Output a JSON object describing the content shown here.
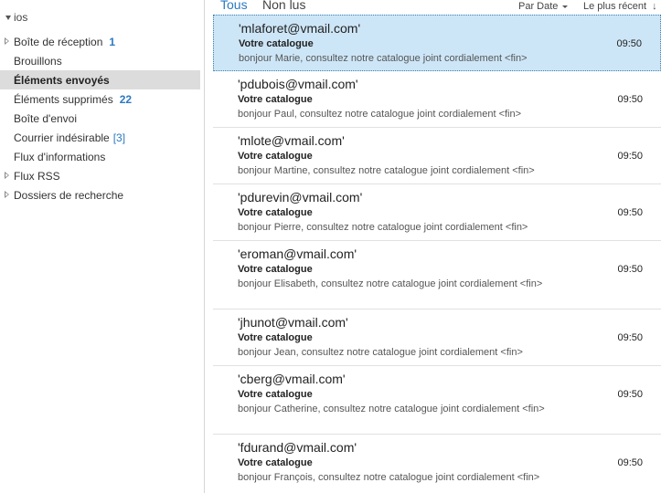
{
  "folder_pane": {
    "account": "ios",
    "folders": [
      {
        "label": "Boîte de réception",
        "count": "1",
        "count_style": "bold",
        "expandable": true,
        "active": false
      },
      {
        "label": "Brouillons",
        "count": "",
        "count_style": "",
        "expandable": false,
        "active": false
      },
      {
        "label": "Éléments envoyés",
        "count": "",
        "count_style": "",
        "expandable": false,
        "active": true
      },
      {
        "label": "Éléments supprimés",
        "count": "22",
        "count_style": "bold",
        "expandable": false,
        "active": false
      },
      {
        "label": "Boîte d'envoi",
        "count": "",
        "count_style": "",
        "expandable": false,
        "active": false
      },
      {
        "label": "Courrier indésirable",
        "count": "[3]",
        "count_style": "bracket",
        "expandable": false,
        "active": false
      },
      {
        "label": "Flux d'informations",
        "count": "",
        "count_style": "",
        "expandable": false,
        "active": false
      },
      {
        "label": "Flux RSS",
        "count": "",
        "count_style": "",
        "expandable": true,
        "active": false
      },
      {
        "label": "Dossiers de recherche",
        "count": "",
        "count_style": "",
        "expandable": true,
        "active": false
      }
    ]
  },
  "filter_bar": {
    "tab_all": "Tous",
    "tab_unread": "Non lus",
    "sort_by": "Par Date",
    "sort_order": "Le plus récent"
  },
  "messages": [
    {
      "sender": "'mlaforet@vmail.com'",
      "subject": "Votre catalogue",
      "preview": "bonjour Marie,    consultez notre catalogue joint  cordialement <fin>",
      "time": "09:50",
      "selected": true,
      "wrapped": false
    },
    {
      "sender": "'pdubois@vmail.com'",
      "subject": "Votre catalogue",
      "preview": "bonjour Paul,    consultez notre catalogue joint  cordialement <fin>",
      "time": "09:50",
      "selected": false,
      "wrapped": false
    },
    {
      "sender": "'mlote@vmail.com'",
      "subject": "Votre catalogue",
      "preview": "bonjour Martine,    consultez notre catalogue joint  cordialement <fin>",
      "time": "09:50",
      "selected": false,
      "wrapped": false
    },
    {
      "sender": "'pdurevin@vmail.com'",
      "subject": "Votre catalogue",
      "preview": "bonjour Pierre,    consultez notre catalogue joint  cordialement <fin>",
      "time": "09:50",
      "selected": false,
      "wrapped": false
    },
    {
      "sender": "'eroman@vmail.com'",
      "subject": "Votre catalogue",
      "preview": "bonjour Elisabeth,    consultez notre catalogue joint  cordialement <fin>",
      "time": "09:50",
      "selected": false,
      "wrapped": true
    },
    {
      "sender": "'jhunot@vmail.com'",
      "subject": "Votre catalogue",
      "preview": "bonjour Jean,    consultez notre catalogue joint  cordialement <fin>",
      "time": "09:50",
      "selected": false,
      "wrapped": false
    },
    {
      "sender": "'cberg@vmail.com'",
      "subject": "Votre catalogue",
      "preview": "bonjour Catherine,    consultez notre catalogue joint  cordialement <fin>",
      "time": "09:50",
      "selected": false,
      "wrapped": true
    },
    {
      "sender": "'fdurand@vmail.com'",
      "subject": "Votre catalogue",
      "preview": "bonjour François,    consultez notre catalogue joint  cordialement <fin>",
      "time": "09:50",
      "selected": false,
      "wrapped": true
    }
  ]
}
